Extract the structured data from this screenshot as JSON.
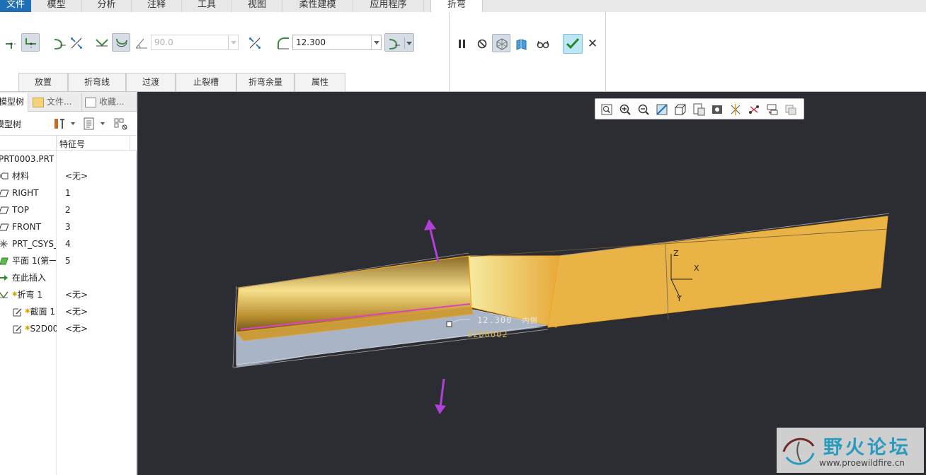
{
  "menu": {
    "tabs": [
      "文件",
      "模型",
      "分析",
      "注释",
      "工具",
      "视图",
      "柔性建模",
      "应用程序",
      "折弯"
    ],
    "active": "折弯"
  },
  "ribbon": {
    "angle_value": "90.0",
    "radius_value": "12.300",
    "subtabs": [
      "放置",
      "折弯线",
      "过渡",
      "止裂槽",
      "折弯余量",
      "属性"
    ]
  },
  "left_panel": {
    "tabs": [
      "模型树",
      "文件...",
      "收藏..."
    ],
    "title": "模型树",
    "column_header": "特征号",
    "root": "PRT0003.PRT",
    "rows": [
      {
        "name": "材料",
        "feat": "<无>"
      },
      {
        "name": "RIGHT",
        "feat": "1"
      },
      {
        "name": "TOP",
        "feat": "2"
      },
      {
        "name": "FRONT",
        "feat": "3"
      },
      {
        "name": "PRT_CSYS_",
        "feat": "4"
      },
      {
        "name": "平面 1(第一",
        "feat": "5"
      },
      {
        "name": "在此插入",
        "feat": ""
      },
      {
        "name": "折弯 1",
        "feat": "<无>"
      },
      {
        "name": "截面 1",
        "feat": "<无>"
      },
      {
        "name": "S2D00",
        "feat": "<无>"
      }
    ]
  },
  "viewport": {
    "dim_label": "12.300",
    "dim_side": "内侧",
    "sketch_label": "S2D0002",
    "axis_x": "X",
    "axis_y": "Y",
    "axis_z": "Z"
  },
  "watermark": {
    "title": "野火论坛",
    "url": "www.proewildfire.cn"
  },
  "colors": {
    "viewport_bg": "#2c2c33",
    "part_orange": "#f0b43a",
    "accent_blue": "#1e6fb8",
    "arrow_purple": "#b040d8"
  }
}
